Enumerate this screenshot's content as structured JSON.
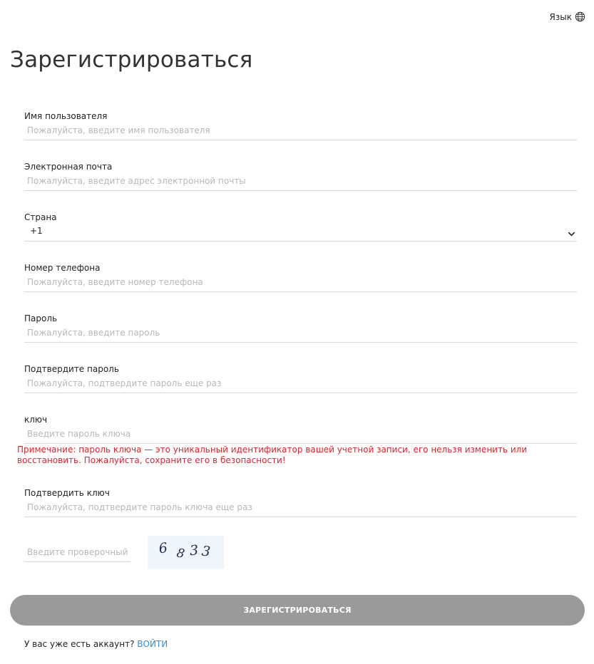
{
  "header": {
    "language_label": "Язык"
  },
  "page_title": "Зарегистрироваться",
  "fields": {
    "username": {
      "label": "Имя пользователя",
      "placeholder": "Пожалуйста, введите имя пользователя",
      "value": ""
    },
    "email": {
      "label": "Электронная почта",
      "placeholder": "Пожалуйста, введите адрес электронной почты",
      "value": ""
    },
    "country": {
      "label": "Страна",
      "selected": "+1"
    },
    "phone": {
      "label": "Номер телефона",
      "placeholder": "Пожалуйста, введите номер телефона",
      "value": ""
    },
    "password": {
      "label": "Пароль",
      "placeholder": "Пожалуйста, введите пароль",
      "value": ""
    },
    "confirm_password": {
      "label": "Подтвердите пароль",
      "placeholder": "Пожалуйста, подтвердите пароль еще раз",
      "value": ""
    },
    "key": {
      "label": "ключ",
      "placeholder": "Введите пароль ключа",
      "value": ""
    },
    "confirm_key": {
      "label": "Подтвердить ключ",
      "placeholder": "Пожалуйста, подтвердите пароль ключа еще раз",
      "value": ""
    }
  },
  "key_note": "Примечание: пароль ключа — это уникальный идентификатор вашей учетной записи, его нельзя изменить или восстановить. Пожалуйста, сохраните его в безопасности!",
  "captcha": {
    "placeholder": "Введите проверочный",
    "code": "6833",
    "digits": [
      "6",
      "8",
      "3",
      "3"
    ],
    "background": "#eef5fb",
    "ink": "#1f2a5a"
  },
  "submit_label": "ЗАРЕГИСТРИРОВАТЬСЯ",
  "login": {
    "prompt": "У вас уже есть аккаунт?",
    "link_label": "ВОЙТИ"
  },
  "colors": {
    "note": "#e8202a",
    "link": "#2a8fe0",
    "button": "#9a9a9a"
  },
  "icons": {
    "language": "globe-icon",
    "country_select": "chevron-down-icon"
  }
}
